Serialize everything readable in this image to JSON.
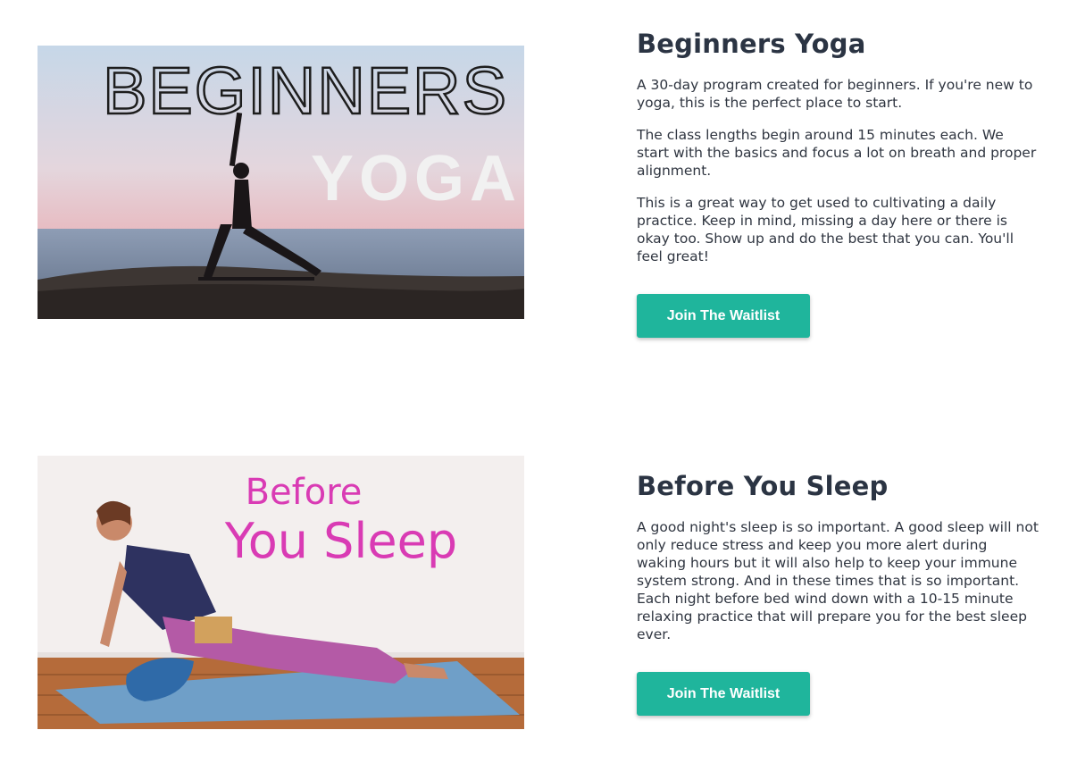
{
  "sections": [
    {
      "image_alt": "Beginners Yoga",
      "image_text_line1": "BEGINNERS",
      "image_text_line2": "YOGA",
      "title": "Beginners Yoga",
      "paragraphs": [
        "A 30-day program created for beginners. If you're new to yoga, this is the perfect place to start.",
        "The class lengths begin around 15 minutes each. We start with the basics and focus a lot on breath and proper alignment.",
        "This is a great way to get used to cultivating a daily practice. Keep in mind, missing a day here or there is okay too. Show up and do the best that you can. You'll feel great!"
      ],
      "button_label": "Join The Waitlist"
    },
    {
      "image_alt": "Before You Sleep",
      "image_text_line1": "Before",
      "image_text_line2": "You Sleep",
      "title": "Before You Sleep",
      "paragraphs": [
        "A good night's sleep is so important. A good sleep will not only reduce stress and keep you more alert during waking hours but it will also help to keep your immune system strong. And in these times that is so important. Each night before bed wind down with a 10-15 minute relaxing practice that will prepare you for the best sleep ever."
      ],
      "button_label": "Join The Waitlist"
    }
  ],
  "colors": {
    "accent": "#1fb59c",
    "heading": "#2b3443",
    "body_text": "#2f3540",
    "sleep_title_pink": "#d93bb4"
  }
}
